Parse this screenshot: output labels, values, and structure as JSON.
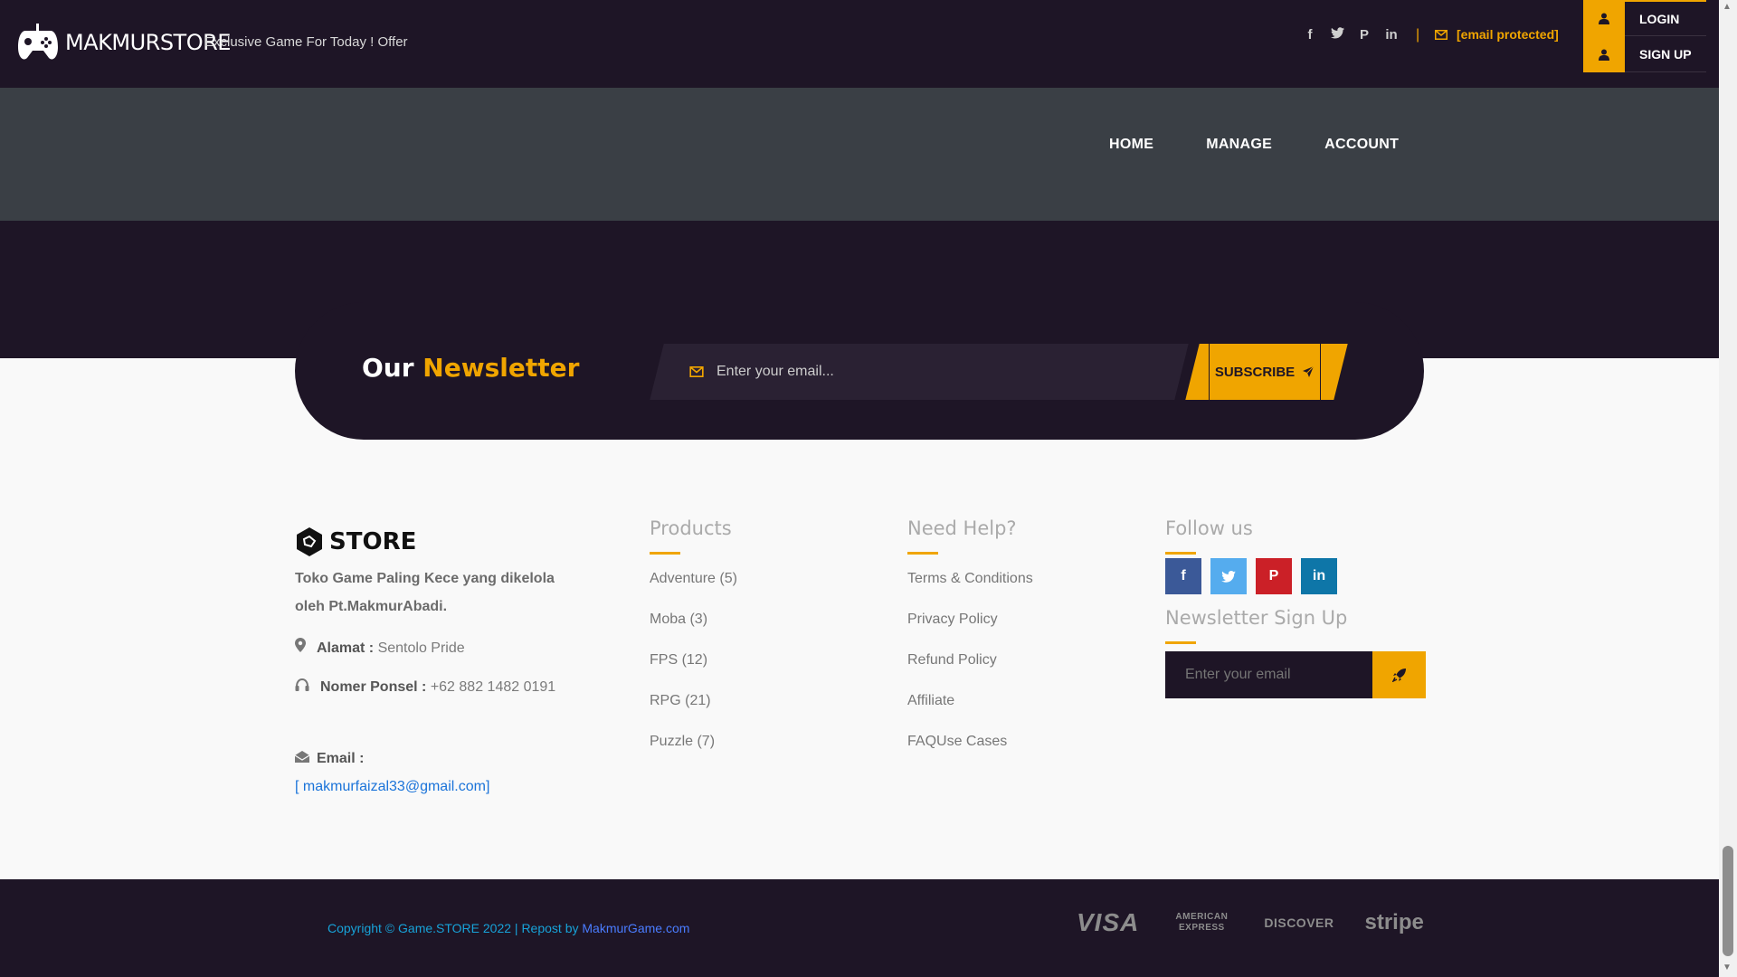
{
  "header": {
    "brand": "MAKMURSTORE",
    "tagline": "Exclusive Game For Today ! Offer",
    "social_icons": [
      "facebook-icon",
      "twitter-icon",
      "pinterest-icon",
      "linkedin-icon"
    ],
    "separator": "|",
    "email": "[email protected]",
    "login_label": "LOGIN",
    "signup_label": "SIGN UP"
  },
  "nav": {
    "items": [
      "HOME",
      "MANAGE",
      "ACCOUNT"
    ]
  },
  "newsletter": {
    "title_plain": "Our",
    "title_accent": "Newsletter",
    "input_placeholder": "Enter your email...",
    "button_label": "SUBSCRIBE"
  },
  "footer": {
    "logo_text": "STORE",
    "about": "Toko Game Paling Kece yang dikelola oleh Pt.MakmurAbadi.",
    "address_label": "Alamat :",
    "address_value": "Sentolo Pride",
    "phone_label": "Nomer Ponsel :",
    "phone_value": "+62 882 1482 0191",
    "email_label": "Email :",
    "email_value": "[ makmurfaizal33@gmail.com]",
    "products": {
      "title": "Products",
      "items": [
        "Adventure (5)",
        "Moba (3)",
        "FPS (12)",
        "RPG (21)",
        "Puzzle (7)"
      ]
    },
    "help": {
      "title": "Need Help?",
      "items": [
        "Terms & Conditions",
        "Privacy Policy",
        "Refund Policy",
        "Affiliate",
        "FAQUse Cases"
      ]
    },
    "follow": {
      "title": "Follow us",
      "signup_title": "Newsletter Sign Up",
      "signup_placeholder": "Enter your email"
    }
  },
  "bottom": {
    "copyright_prefix": "Copyright © Game.STORE 2022 | Repost by ",
    "copyright_link": "MakmurGame.com",
    "payment": [
      "VISA",
      "AMERICAN EXPRESS",
      "DISCOVER",
      "stripe"
    ]
  },
  "colors": {
    "dark": "#1e1526",
    "accent": "#f0a500",
    "navband": "#3a3f45"
  }
}
